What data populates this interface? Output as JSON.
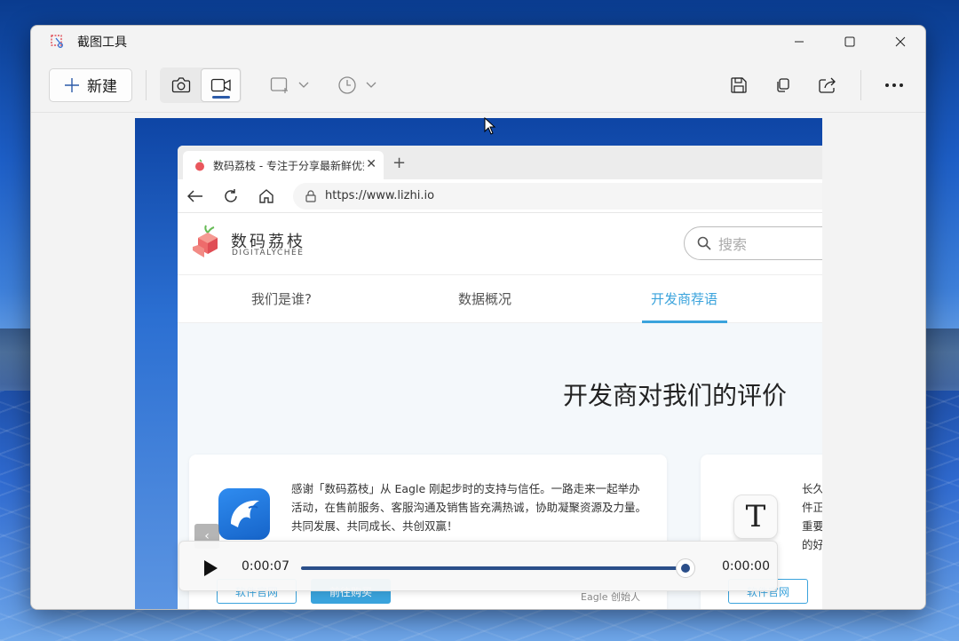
{
  "window": {
    "title": "截图工具"
  },
  "toolbar": {
    "new_label": "新建",
    "screenshot_mode": "camera-icon",
    "video_mode": "video-camera-icon",
    "active_mode": "video"
  },
  "browser": {
    "tab_title": "数码荔枝 - 专注于分享最新鲜优秀",
    "url": "https://www.lizhi.io"
  },
  "site": {
    "logo_cn": "数码荔枝",
    "logo_en": "DIGITALYCHEE",
    "search_placeholder": "搜索",
    "tabs": [
      {
        "label": "我们是谁?"
      },
      {
        "label": "数据概况"
      },
      {
        "label": "开发商荐语"
      }
    ],
    "section_title": "开发商对我们的评价",
    "card1": {
      "quote": "感谢「数码荔枝」从 Eagle 刚起步时的支持与信任。一路走来一起举办活动，在售前服务、客服沟通及销售皆充满热诚，协助凝聚资源及力量。共同发展、共同成长、共创双赢！",
      "author": "Eagle 创始人",
      "btn_official": "软件官网",
      "btn_buy": "前往购买"
    },
    "card2": {
      "logo_letter": "T",
      "text": "长久件正重要的好",
      "btn_official": "软件官网"
    }
  },
  "player": {
    "current_time": "0:00:07",
    "total_time": "0:00:00",
    "progress": 0.98
  },
  "colors": {
    "accent": "#3aa3dc",
    "player_track": "#2b4f8a"
  }
}
